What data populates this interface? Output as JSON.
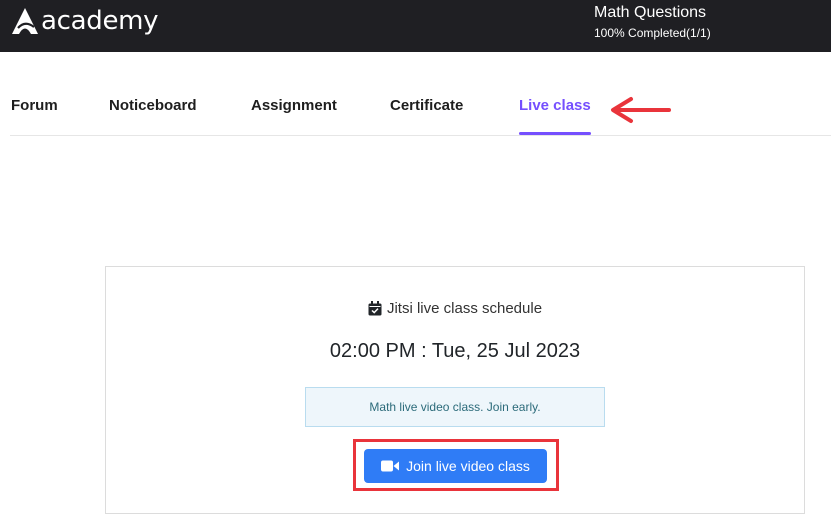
{
  "header": {
    "logo_text": "academy",
    "course_title": "Math Questions",
    "course_progress": "100% Completed(1/1)"
  },
  "tabs": [
    {
      "label": "Forum",
      "active": false
    },
    {
      "label": "Noticeboard",
      "active": false
    },
    {
      "label": "Assignment",
      "active": false
    },
    {
      "label": "Certificate",
      "active": false
    },
    {
      "label": "Live class",
      "active": true
    }
  ],
  "live_class": {
    "schedule_label": "Jitsi live class schedule",
    "schedule_time": "02:00 PM : Tue, 25 Jul 2023",
    "notice": "Math live video class. Join early.",
    "join_button": "Join live video class"
  },
  "colors": {
    "accent": "#754ffe",
    "header_bg": "#1f1f23",
    "button": "#2f7cf6",
    "annotation": "#e9343b"
  },
  "icons": [
    "logo-icon",
    "calendar-icon",
    "video-icon",
    "arrow-left-icon"
  ]
}
